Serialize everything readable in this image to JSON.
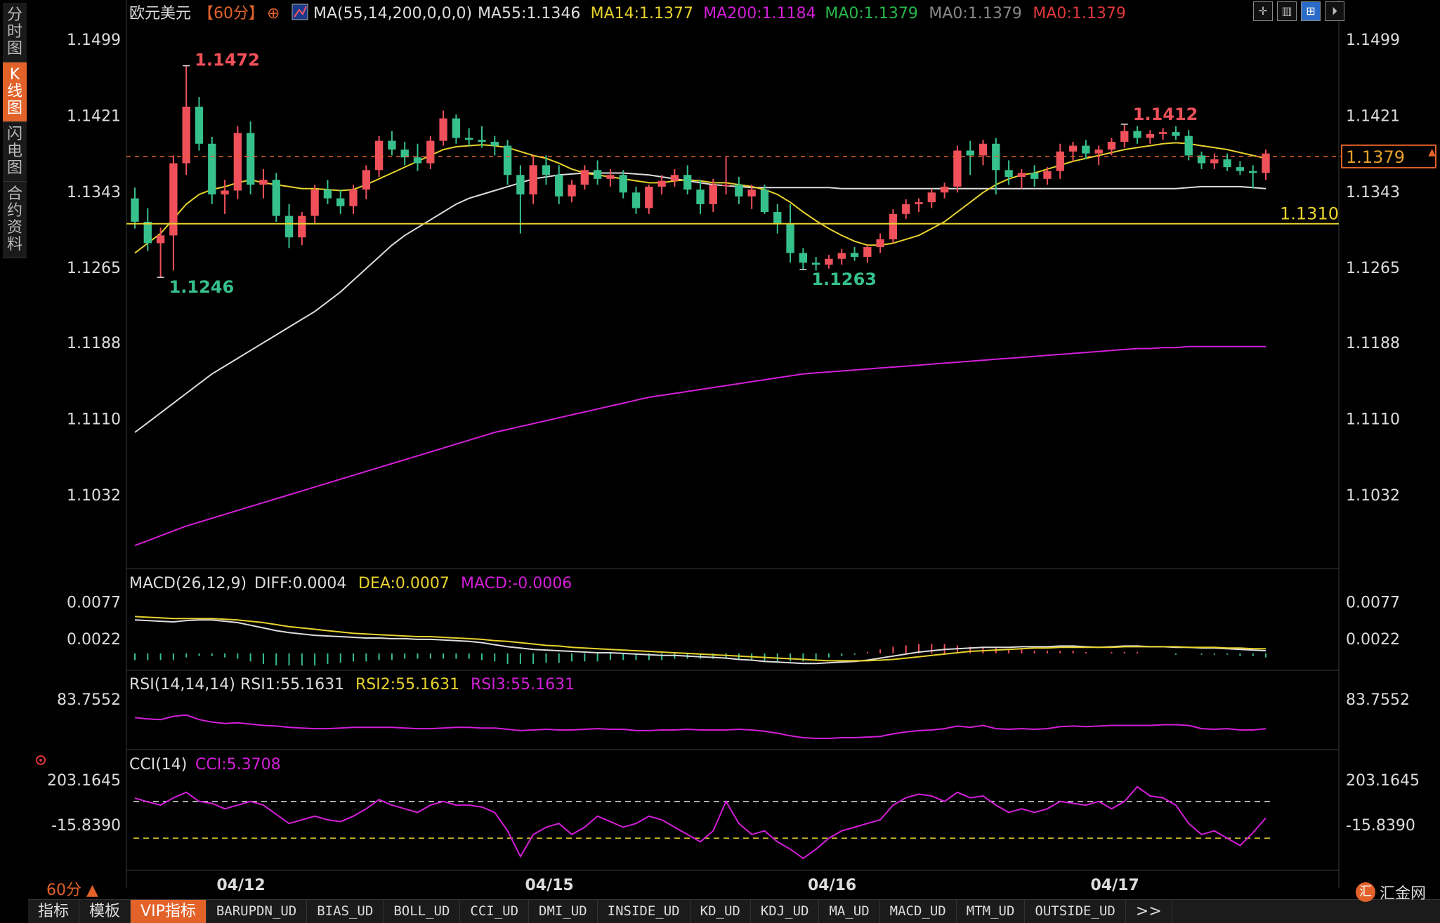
{
  "side_tabs": [
    "分时图",
    "K线图",
    "闪电图",
    "合约资料"
  ],
  "active_side_tab": 1,
  "header": {
    "symbol": "欧元美元",
    "period": "【60分】",
    "ma_spec": "MA(55,14,200,0,0,0)",
    "ma_values": [
      {
        "text": "MA55:1.1346",
        "color": "#dddddd"
      },
      {
        "text": "MA14:1.1377",
        "color": "#e8d22c"
      },
      {
        "text": "MA200:1.1184",
        "color": "#d31ed8"
      },
      {
        "text": "MA0:1.1379",
        "color": "#28b84a"
      },
      {
        "text": "MA0:1.1379",
        "color": "#888888"
      },
      {
        "text": "MA0:1.1379",
        "color": "#e0383c"
      }
    ]
  },
  "main_axis_labels": [
    "1.1499",
    "1.1421",
    "1.1343",
    "1.1265",
    "1.1188",
    "1.1110",
    "1.1032"
  ],
  "annotations": {
    "high": "1.1472",
    "low": "1.1246",
    "high2": "1.1412",
    "low2": "1.1263",
    "current_price": "1.1379",
    "hline": "1.1310"
  },
  "macd": {
    "title": "MACD(26,12,9)",
    "diff": "DIFF:0.0004",
    "dea": "DEA:0.0007",
    "macd": "MACD:-0.0006",
    "axis_labels": [
      "0.0077",
      "0.0022"
    ]
  },
  "rsi": {
    "title": "RSI(14,14,14)",
    "rsi1": "RSI1:55.1631",
    "rsi2": "RSI2:55.1631",
    "rsi3": "RSI3:55.1631",
    "axis_labels": [
      "83.7552"
    ]
  },
  "cci": {
    "title": "CCI(14)",
    "value": "CCI:5.3708",
    "axis_labels": [
      "203.1645",
      "-15.8390"
    ]
  },
  "dates": [
    "04/12",
    "04/15",
    "04/16",
    "04/17"
  ],
  "period_label": "60分 ▲",
  "bottom_tabs": [
    "指标",
    "模板",
    "VIP指标",
    "BARUPDN_UD",
    "BIAS_UD",
    "BOLL_UD",
    "CCI_UD",
    "DMI_UD",
    "INSIDE_UD",
    "KD_UD",
    "KDJ_UD",
    "MA_UD",
    "MACD_UD",
    "MTM_UD",
    "OUTSIDE_UD",
    ">>"
  ],
  "active_bottom_tab": 2,
  "logo_text": "汇金网",
  "colors": {
    "up": "#f0505a",
    "down": "#36c08c",
    "ma14": "#e8d22c",
    "ma55": "#dddddd",
    "ma200": "#d31ed8",
    "accent": "#e2622a"
  },
  "chart_data": {
    "type": "line",
    "title": "欧元美元【60分】",
    "candles_ohlc": [
      [
        1.1336,
        1.1347,
        1.1305,
        1.1312
      ],
      [
        1.1312,
        1.1326,
        1.1282,
        1.129
      ],
      [
        1.129,
        1.1306,
        1.1255,
        1.1298
      ],
      [
        1.1298,
        1.138,
        1.1262,
        1.1372
      ],
      [
        1.1372,
        1.1472,
        1.136,
        1.143
      ],
      [
        1.143,
        1.144,
        1.1385,
        1.1392
      ],
      [
        1.1392,
        1.1399,
        1.133,
        1.134
      ],
      [
        1.134,
        1.1355,
        1.132,
        1.1344
      ],
      [
        1.1344,
        1.141,
        1.1335,
        1.1403
      ],
      [
        1.1403,
        1.1415,
        1.134,
        1.135
      ],
      [
        1.135,
        1.1366,
        1.1336,
        1.1355
      ],
      [
        1.1355,
        1.1362,
        1.1312,
        1.1318
      ],
      [
        1.1318,
        1.133,
        1.1285,
        1.1296
      ],
      [
        1.1296,
        1.1322,
        1.1288,
        1.1318
      ],
      [
        1.1318,
        1.135,
        1.131,
        1.1345
      ],
      [
        1.1345,
        1.1355,
        1.133,
        1.1336
      ],
      [
        1.1336,
        1.1345,
        1.132,
        1.1328
      ],
      [
        1.1328,
        1.135,
        1.132,
        1.1345
      ],
      [
        1.1345,
        1.137,
        1.1335,
        1.1365
      ],
      [
        1.1365,
        1.14,
        1.1358,
        1.1395
      ],
      [
        1.1395,
        1.1405,
        1.138,
        1.1386
      ],
      [
        1.1386,
        1.1394,
        1.137,
        1.1378
      ],
      [
        1.1378,
        1.1392,
        1.1364,
        1.1372
      ],
      [
        1.1372,
        1.14,
        1.1366,
        1.1395
      ],
      [
        1.1395,
        1.1426,
        1.139,
        1.1418
      ],
      [
        1.1418,
        1.1422,
        1.1392,
        1.1398
      ],
      [
        1.1398,
        1.1408,
        1.139,
        1.1396
      ],
      [
        1.1396,
        1.141,
        1.1388,
        1.1394
      ],
      [
        1.1394,
        1.14,
        1.138,
        1.139
      ],
      [
        1.139,
        1.1396,
        1.135,
        1.136
      ],
      [
        1.136,
        1.137,
        1.13,
        1.134
      ],
      [
        1.134,
        1.138,
        1.133,
        1.137
      ],
      [
        1.137,
        1.138,
        1.135,
        1.136
      ],
      [
        1.136,
        1.137,
        1.133,
        1.1338
      ],
      [
        1.1338,
        1.1355,
        1.1332,
        1.135
      ],
      [
        1.135,
        1.137,
        1.1345,
        1.1365
      ],
      [
        1.1365,
        1.1375,
        1.135,
        1.1356
      ],
      [
        1.1356,
        1.1366,
        1.1348,
        1.136
      ],
      [
        1.136,
        1.1365,
        1.1336,
        1.1342
      ],
      [
        1.1342,
        1.1348,
        1.132,
        1.1326
      ],
      [
        1.1326,
        1.135,
        1.132,
        1.1348
      ],
      [
        1.1348,
        1.136,
        1.134,
        1.1354
      ],
      [
        1.1354,
        1.1366,
        1.1348,
        1.136
      ],
      [
        1.136,
        1.137,
        1.134,
        1.1345
      ],
      [
        1.1345,
        1.1355,
        1.132,
        1.133
      ],
      [
        1.133,
        1.1356,
        1.1322,
        1.135
      ],
      [
        1.135,
        1.1378,
        1.134,
        1.135
      ],
      [
        1.135,
        1.1358,
        1.133,
        1.1338
      ],
      [
        1.1338,
        1.135,
        1.1325,
        1.1345
      ],
      [
        1.1345,
        1.135,
        1.132,
        1.1322
      ],
      [
        1.1322,
        1.133,
        1.13,
        1.131
      ],
      [
        1.131,
        1.133,
        1.127,
        1.128
      ],
      [
        1.128,
        1.1285,
        1.1263,
        1.127
      ],
      [
        1.127,
        1.1276,
        1.1262,
        1.1268
      ],
      [
        1.1268,
        1.1278,
        1.1264,
        1.1274
      ],
      [
        1.1274,
        1.1284,
        1.1268,
        1.128
      ],
      [
        1.128,
        1.1286,
        1.1272,
        1.1276
      ],
      [
        1.1276,
        1.1288,
        1.127,
        1.1286
      ],
      [
        1.1286,
        1.13,
        1.128,
        1.1294
      ],
      [
        1.1294,
        1.1325,
        1.129,
        1.132
      ],
      [
        1.132,
        1.1335,
        1.1315,
        1.133
      ],
      [
        1.133,
        1.1336,
        1.1322,
        1.1332
      ],
      [
        1.1332,
        1.1346,
        1.1326,
        1.1342
      ],
      [
        1.1342,
        1.1352,
        1.1336,
        1.1348
      ],
      [
        1.1348,
        1.139,
        1.1342,
        1.1385
      ],
      [
        1.1385,
        1.1395,
        1.136,
        1.138
      ],
      [
        1.138,
        1.1396,
        1.137,
        1.1392
      ],
      [
        1.1392,
        1.1398,
        1.134,
        1.1365
      ],
      [
        1.1365,
        1.1375,
        1.135,
        1.1358
      ],
      [
        1.1358,
        1.1366,
        1.1346,
        1.1362
      ],
      [
        1.1362,
        1.137,
        1.1348,
        1.1356
      ],
      [
        1.1356,
        1.1368,
        1.135,
        1.1364
      ],
      [
        1.1364,
        1.1392,
        1.1356,
        1.1384
      ],
      [
        1.1384,
        1.1394,
        1.1374,
        1.139
      ],
      [
        1.139,
        1.1396,
        1.1376,
        1.1382
      ],
      [
        1.1382,
        1.139,
        1.137,
        1.1386
      ],
      [
        1.1386,
        1.1398,
        1.138,
        1.1394
      ],
      [
        1.1394,
        1.1412,
        1.1388,
        1.1405
      ],
      [
        1.1405,
        1.141,
        1.1392,
        1.1398
      ],
      [
        1.1398,
        1.1406,
        1.1392,
        1.1402
      ],
      [
        1.1402,
        1.1408,
        1.1396,
        1.1404
      ],
      [
        1.1404,
        1.141,
        1.1396,
        1.14
      ],
      [
        1.14,
        1.1406,
        1.1375,
        1.138
      ],
      [
        1.138,
        1.1384,
        1.1366,
        1.1372
      ],
      [
        1.1372,
        1.1382,
        1.1366,
        1.1376
      ],
      [
        1.1376,
        1.1382,
        1.1364,
        1.1368
      ],
      [
        1.1368,
        1.1374,
        1.136,
        1.1364
      ],
      [
        1.1364,
        1.137,
        1.1346,
        1.1362
      ],
      [
        1.1362,
        1.1386,
        1.1355,
        1.1382
      ]
    ],
    "ma14": [
      1.128,
      1.129,
      1.13,
      1.1315,
      1.133,
      1.134,
      1.1345,
      1.1348,
      1.1352,
      1.1355,
      1.1352,
      1.135,
      1.1348,
      1.1346,
      1.1346,
      1.1345,
      1.1344,
      1.1345,
      1.135,
      1.1356,
      1.1362,
      1.1368,
      1.1374,
      1.138,
      1.1386,
      1.1389,
      1.139,
      1.1391,
      1.139,
      1.1388,
      1.1384,
      1.138,
      1.1377,
      1.1372,
      1.1366,
      1.1362,
      1.136,
      1.1358,
      1.1356,
      1.1354,
      1.1352,
      1.1352,
      1.1354,
      1.1355,
      1.1354,
      1.1352,
      1.1352,
      1.135,
      1.1348,
      1.1345,
      1.134,
      1.1332,
      1.1322,
      1.1313,
      1.1305,
      1.1298,
      1.1292,
      1.1288,
      1.1288,
      1.129,
      1.1294,
      1.1298,
      1.1305,
      1.1312,
      1.1322,
      1.1332,
      1.1342,
      1.135,
      1.1356,
      1.136,
      1.1362,
      1.1366,
      1.137,
      1.1374,
      1.1377,
      1.138,
      1.1383,
      1.1386,
      1.1388,
      1.139,
      1.1392,
      1.1393,
      1.1392,
      1.139,
      1.1388,
      1.1386,
      1.1383,
      1.138,
      1.1377
    ],
    "ma55": [
      1.1096,
      1.1106,
      1.1116,
      1.1126,
      1.1136,
      1.1146,
      1.1156,
      1.1164,
      1.1172,
      1.118,
      1.1188,
      1.1196,
      1.1204,
      1.1212,
      1.122,
      1.123,
      1.124,
      1.1252,
      1.1264,
      1.1276,
      1.1288,
      1.1298,
      1.1306,
      1.1314,
      1.1322,
      1.133,
      1.1336,
      1.134,
      1.1344,
      1.1348,
      1.1352,
      1.1356,
      1.1358,
      1.136,
      1.1361,
      1.1362,
      1.1362,
      1.1362,
      1.1362,
      1.1361,
      1.136,
      1.1358,
      1.1356,
      1.1354,
      1.1352,
      1.135,
      1.1349,
      1.1348,
      1.1347,
      1.1347,
      1.1347,
      1.1347,
      1.1347,
      1.1347,
      1.1347,
      1.1346,
      1.1346,
      1.1346,
      1.1346,
      1.1346,
      1.1346,
      1.1346,
      1.1346,
      1.1346,
      1.1346,
      1.1346,
      1.1346,
      1.1346,
      1.1346,
      1.1346,
      1.1346,
      1.1346,
      1.1346,
      1.1346,
      1.1346,
      1.1346,
      1.1346,
      1.1346,
      1.1346,
      1.1346,
      1.1346,
      1.1346,
      1.1347,
      1.1348,
      1.1348,
      1.1348,
      1.1348,
      1.1347,
      1.1346
    ],
    "ma200": [
      1.098,
      1.0985,
      1.099,
      1.0995,
      1.1,
      1.1004,
      1.1008,
      1.1012,
      1.1016,
      1.102,
      1.1024,
      1.1028,
      1.1032,
      1.1036,
      1.104,
      1.1044,
      1.1048,
      1.1052,
      1.1056,
      1.106,
      1.1064,
      1.1068,
      1.1072,
      1.1076,
      1.108,
      1.1084,
      1.1088,
      1.1092,
      1.1096,
      1.1099,
      1.1102,
      1.1105,
      1.1108,
      1.1111,
      1.1114,
      1.1117,
      1.112,
      1.1123,
      1.1126,
      1.1129,
      1.1132,
      1.1134,
      1.1136,
      1.1138,
      1.114,
      1.1142,
      1.1144,
      1.1146,
      1.1148,
      1.115,
      1.1152,
      1.1154,
      1.1156,
      1.1157,
      1.1158,
      1.1159,
      1.116,
      1.1161,
      1.1162,
      1.1163,
      1.1164,
      1.1165,
      1.1166,
      1.1167,
      1.1168,
      1.1169,
      1.117,
      1.1171,
      1.1172,
      1.1173,
      1.1174,
      1.1175,
      1.1176,
      1.1177,
      1.1178,
      1.1179,
      1.118,
      1.1181,
      1.1182,
      1.1182,
      1.1183,
      1.1183,
      1.1184,
      1.1184,
      1.1184,
      1.1184,
      1.1184,
      1.1184,
      1.1184
    ],
    "hline": 1.131,
    "dashed_level": 1.1379,
    "main_ylim": [
      1.096,
      1.1525
    ],
    "macd_diff": [
      0.005,
      0.0049,
      0.0048,
      0.0047,
      0.0049,
      0.005,
      0.005,
      0.0048,
      0.0046,
      0.0042,
      0.0038,
      0.0034,
      0.0031,
      0.0029,
      0.0027,
      0.0026,
      0.0025,
      0.0024,
      0.0023,
      0.0023,
      0.0022,
      0.0022,
      0.0021,
      0.0021,
      0.002,
      0.0019,
      0.0018,
      0.0016,
      0.0013,
      0.001,
      0.0008,
      0.0006,
      0.0005,
      0.0004,
      0.0003,
      0.0002,
      0.0001,
      0.0001,
      0.0,
      -0.0001,
      -0.0002,
      -0.0003,
      -0.0003,
      -0.0004,
      -0.0005,
      -0.0006,
      -0.0007,
      -0.0009,
      -0.001,
      -0.0012,
      -0.0013,
      -0.0014,
      -0.0015,
      -0.0015,
      -0.0014,
      -0.0013,
      -0.0012,
      -0.001,
      -0.0007,
      -0.0004,
      -0.0001,
      0.0002,
      0.0004,
      0.0006,
      0.0007,
      0.0008,
      0.0009,
      0.0009,
      0.0009,
      0.001,
      0.001,
      0.001,
      0.0011,
      0.0011,
      0.001,
      0.0009,
      0.001,
      0.0011,
      0.0011,
      0.001,
      0.001,
      0.0009,
      0.0009,
      0.0008,
      0.0008,
      0.0007,
      0.0006,
      0.0005,
      0.0004
    ],
    "macd_dea": [
      0.0055,
      0.0054,
      0.0053,
      0.0052,
      0.0052,
      0.0052,
      0.0052,
      0.0051,
      0.005,
      0.0048,
      0.0046,
      0.0043,
      0.004,
      0.0038,
      0.0036,
      0.0034,
      0.0032,
      0.003,
      0.0029,
      0.0028,
      0.0027,
      0.0026,
      0.0025,
      0.0025,
      0.0024,
      0.0023,
      0.0022,
      0.0021,
      0.0019,
      0.0018,
      0.0016,
      0.0014,
      0.0012,
      0.0011,
      0.0009,
      0.0008,
      0.0007,
      0.0006,
      0.0005,
      0.0004,
      0.0003,
      0.0002,
      0.0001,
      0.0,
      -0.0001,
      -0.0002,
      -0.0003,
      -0.0004,
      -0.0005,
      -0.0006,
      -0.0007,
      -0.0008,
      -0.0009,
      -0.001,
      -0.0011,
      -0.0011,
      -0.0011,
      -0.0011,
      -0.001,
      -0.0009,
      -0.0007,
      -0.0005,
      -0.0003,
      -0.0001,
      0.0001,
      0.0003,
      0.0004,
      0.0005,
      0.0006,
      0.0007,
      0.0008,
      0.0008,
      0.0009,
      0.0009,
      0.0009,
      0.0009,
      0.0009,
      0.001,
      0.001,
      0.001,
      0.001,
      0.001,
      0.0009,
      0.0009,
      0.0009,
      0.0008,
      0.0008,
      0.0007,
      0.0007
    ],
    "macd_ylim": [
      -0.002,
      0.009
    ],
    "rsi": [
      55,
      53,
      52,
      57,
      59,
      52,
      48,
      46,
      47,
      45,
      43,
      42,
      40,
      39,
      38,
      38,
      39,
      40,
      40,
      40,
      40,
      39,
      38,
      38,
      39,
      40,
      40,
      39,
      39,
      37,
      35,
      36,
      37,
      36,
      36,
      37,
      38,
      37,
      37,
      35,
      35,
      36,
      36,
      37,
      36,
      36,
      36,
      37,
      36,
      34,
      31,
      27,
      24,
      23,
      23,
      24,
      24,
      25,
      26,
      30,
      33,
      35,
      36,
      38,
      42,
      40,
      43,
      38,
      37,
      38,
      37,
      38,
      41,
      42,
      41,
      42,
      43,
      43,
      43,
      43,
      44,
      44,
      43,
      38,
      37,
      38,
      36,
      36,
      38
    ],
    "rsi_ylim": [
      10,
      90
    ],
    "cci": [
      118,
      98,
      80,
      120,
      150,
      100,
      90,
      60,
      80,
      100,
      80,
      30,
      -20,
      0,
      20,
      0,
      -10,
      20,
      60,
      110,
      80,
      60,
      40,
      80,
      100,
      80,
      80,
      70,
      40,
      -60,
      -200,
      -80,
      -40,
      -20,
      -80,
      -40,
      20,
      -10,
      -40,
      -20,
      20,
      0,
      -40,
      -80,
      -120,
      -60,
      100,
      -20,
      -80,
      -60,
      -120,
      -160,
      -210,
      -160,
      -100,
      -60,
      -40,
      -20,
      0,
      80,
      120,
      140,
      130,
      100,
      150,
      120,
      130,
      80,
      40,
      60,
      40,
      60,
      100,
      90,
      80,
      100,
      60,
      100,
      180,
      130,
      120,
      80,
      -20,
      -80,
      -60,
      -100,
      -140,
      -70,
      10
    ],
    "cci_levels": [
      100,
      -100
    ],
    "cci_ylim": [
      -260,
      260
    ]
  }
}
